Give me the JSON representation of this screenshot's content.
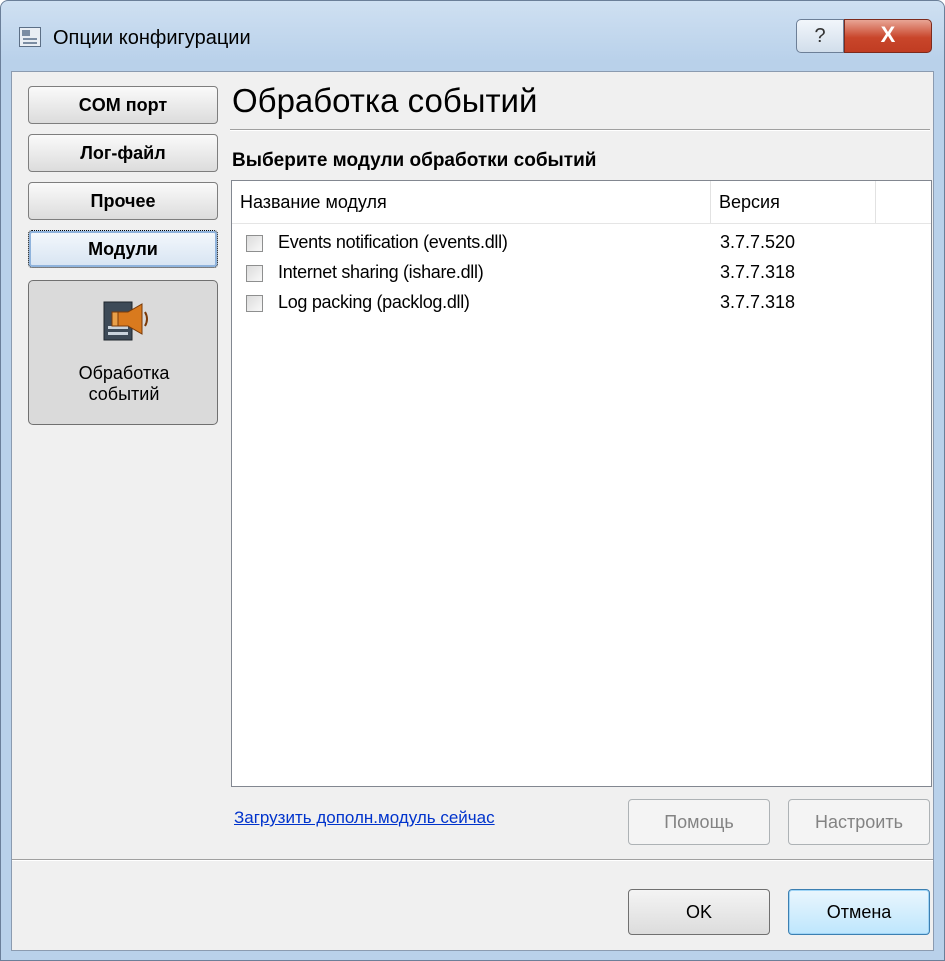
{
  "window": {
    "title": "Опции конфигурации",
    "help_glyph": "?",
    "close_glyph": "X"
  },
  "nav": {
    "items": [
      {
        "label": "COM порт"
      },
      {
        "label": "Лог-файл"
      },
      {
        "label": "Прочее"
      },
      {
        "label": "Модули"
      }
    ],
    "module": {
      "label_line1": "Обработка",
      "label_line2": "событий",
      "icon": "speaker-module-icon"
    }
  },
  "main": {
    "title": "Обработка событий",
    "subheading": "Выберите модули обработки событий",
    "columns": {
      "name": "Название модуля",
      "version": "Версия"
    },
    "modules": [
      {
        "name": "Events notification (events.dll)",
        "version": "3.7.7.520",
        "checked": false
      },
      {
        "name": "Internet sharing (ishare.dll)",
        "version": "3.7.7.318",
        "checked": false
      },
      {
        "name": "Log packing (packlog.dll)",
        "version": "3.7.7.318",
        "checked": false
      }
    ],
    "download_link": "Загрузить дополн.модуль сейчас",
    "help_button": "Помощь",
    "configure_button": "Настроить"
  },
  "footer": {
    "ok_button": "OK",
    "cancel_button": "Отмена"
  }
}
